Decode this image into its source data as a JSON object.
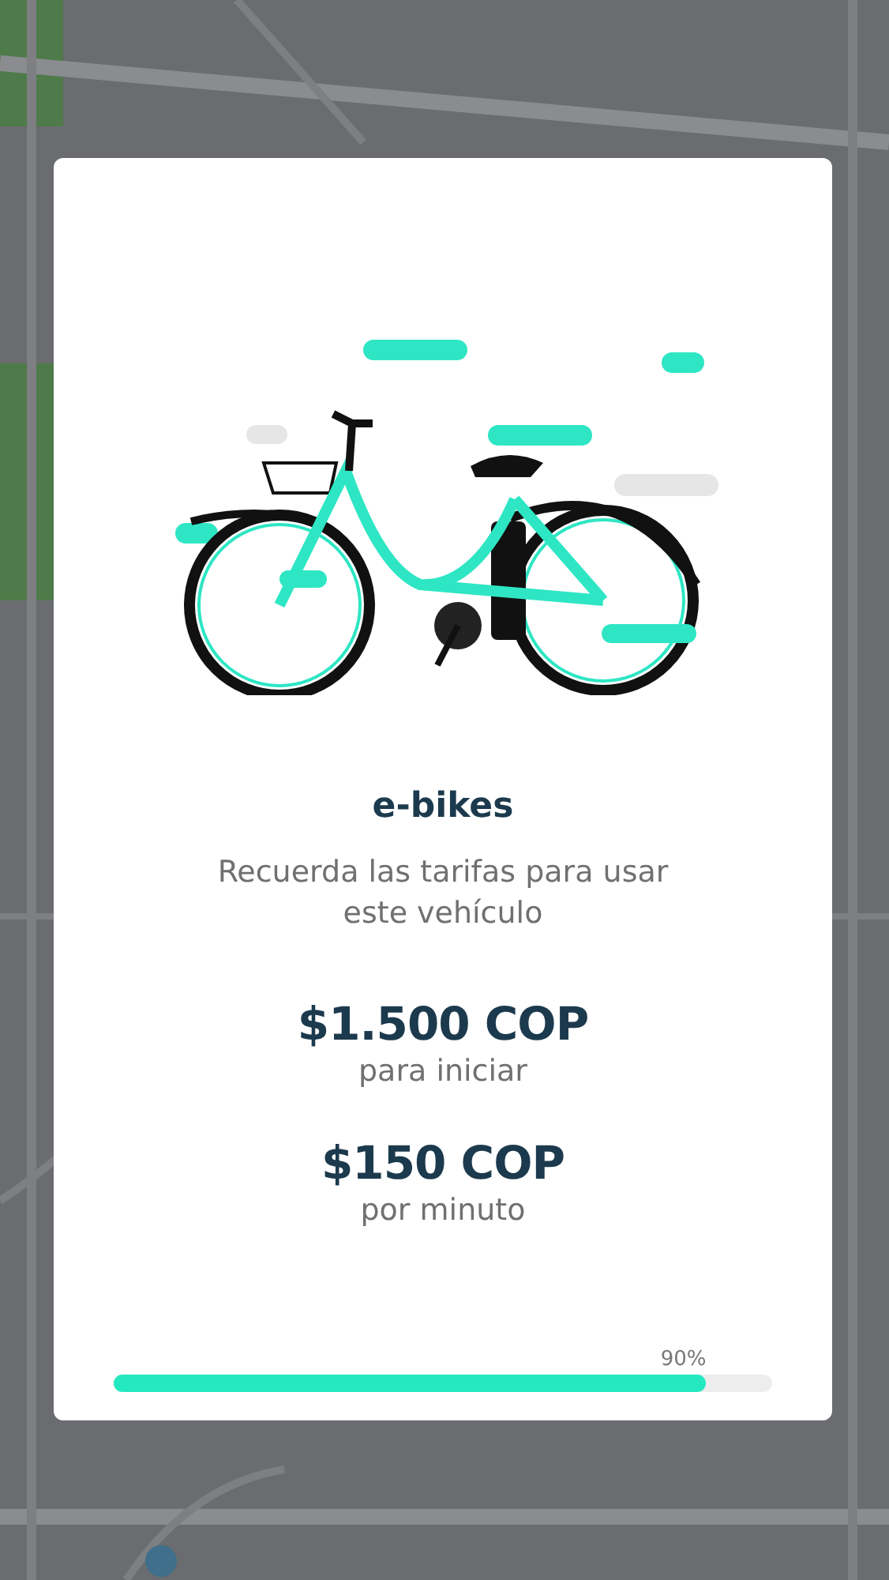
{
  "dialog": {
    "title": "e-bikes",
    "subtitle": "Recuerda las tarifas para usar este vehículo",
    "fares": [
      {
        "price": "$1.500 COP",
        "label": "para iniciar"
      },
      {
        "price": "$150 COP",
        "label": "por minuto"
      }
    ],
    "progress": {
      "level": 0.9,
      "reading": "90%"
    }
  }
}
